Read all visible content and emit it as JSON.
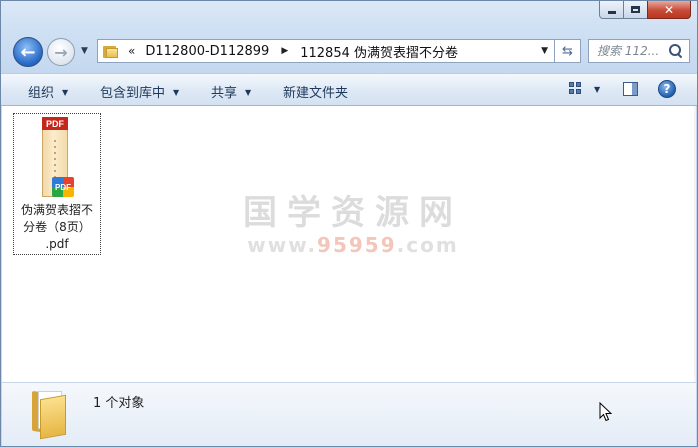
{
  "window": {
    "caption_buttons": {
      "minimize_icon": "minimize-icon",
      "maximize_icon": "maximize-icon",
      "close_icon": "close-icon",
      "close_glyph": "✕"
    }
  },
  "navigation": {
    "back_glyph": "←",
    "forward_glyph": "→",
    "history_dropdown_glyph": "▼",
    "address": {
      "overflow_glyph": "«",
      "crumbs": [
        "D112800-D112899",
        "112854 伪满贺表摺不分卷"
      ],
      "separator_glyph": "▶",
      "dropdown_glyph": "▼"
    },
    "refresh_glyph": "⇆",
    "search": {
      "placeholder": "搜索 112..."
    }
  },
  "command_bar": {
    "organize": "组织",
    "include_in_library": "包含到库中",
    "share": "共享",
    "new_folder": "新建文件夹",
    "dropdown_glyph": "▼",
    "help_glyph": "?"
  },
  "files": [
    {
      "name": "伪满贺表摺不分卷（8页）.pdf",
      "display_name": "伪满贺表摺不\n分卷（8页）\n.pdf",
      "icon": "pdf-file-icon",
      "banner": "PDF",
      "badge": "PDF"
    }
  ],
  "watermark": {
    "title": "国学资源网",
    "url_prefix": "www.",
    "url_highlight": "95959",
    "url_suffix": ".com"
  },
  "details_pane": {
    "count_text": "1 个对象"
  },
  "colors": {
    "frame": "#c4d8ef",
    "command_text": "#1e395b",
    "pdf_red": "#c4281c",
    "close_red": "#c74b38"
  }
}
